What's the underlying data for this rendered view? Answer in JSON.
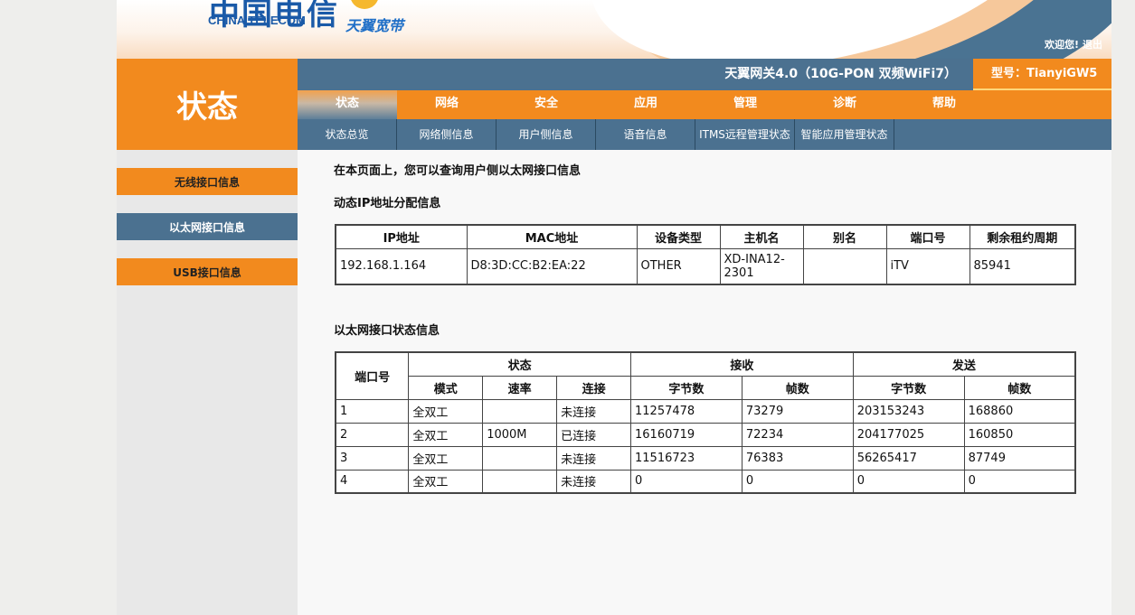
{
  "brand": {
    "logo_cn": "中国电信",
    "logo_en": "CHINA TELECOM",
    "logo2": "天翼宽带"
  },
  "welcome": {
    "text": "欢迎您!",
    "logout": "退出"
  },
  "header": {
    "title": "天翼网关4.0（10G-PON 双频WiFi7）",
    "model": "型号：TianyiGW5"
  },
  "side_title": "状态",
  "main_tabs": [
    "状态",
    "网络",
    "安全",
    "应用",
    "管理",
    "诊断",
    "帮助"
  ],
  "sub_tabs": [
    "状态总览",
    "网络侧信息",
    "用户侧信息",
    "语音信息",
    "ITMS远程管理状态",
    "智能应用管理状态"
  ],
  "sidebar": [
    "无线接口信息",
    "以太网接口信息",
    "USB接口信息"
  ],
  "content": {
    "intro": "在本页面上，您可以查询用户侧以太网接口信息",
    "dhcp_title": "动态IP地址分配信息",
    "dhcp_headers": [
      "IP地址",
      "MAC地址",
      "设备类型",
      "主机名",
      "别名",
      "端口号",
      "剩余租约周期"
    ],
    "dhcp_rows": [
      [
        "192.168.1.164",
        "D8:3D:CC:B2:EA:22",
        "OTHER",
        "XD-INA12-2301",
        "",
        "iTV",
        "85941"
      ]
    ],
    "eth_title": "以太网接口状态信息",
    "eth_headers": {
      "port": "端口号",
      "status": "状态",
      "rx": "接收",
      "tx": "发送",
      "mode": "模式",
      "speed": "速率",
      "link": "连接",
      "bytes": "字节数",
      "frames": "帧数"
    },
    "eth_rows": [
      [
        "1",
        "全双工",
        "",
        "未连接",
        "11257478",
        "73279",
        "203153243",
        "168860"
      ],
      [
        "2",
        "全双工",
        "1000M",
        "已连接",
        "16160719",
        "72234",
        "204177025",
        "160850"
      ],
      [
        "3",
        "全双工",
        "",
        "未连接",
        "11516723",
        "76383",
        "56265417",
        "87749"
      ],
      [
        "4",
        "全双工",
        "",
        "未连接",
        "0",
        "0",
        "0",
        "0"
      ]
    ]
  },
  "colors": {
    "orange": "#f28a1e",
    "blue": "#4b7190"
  }
}
